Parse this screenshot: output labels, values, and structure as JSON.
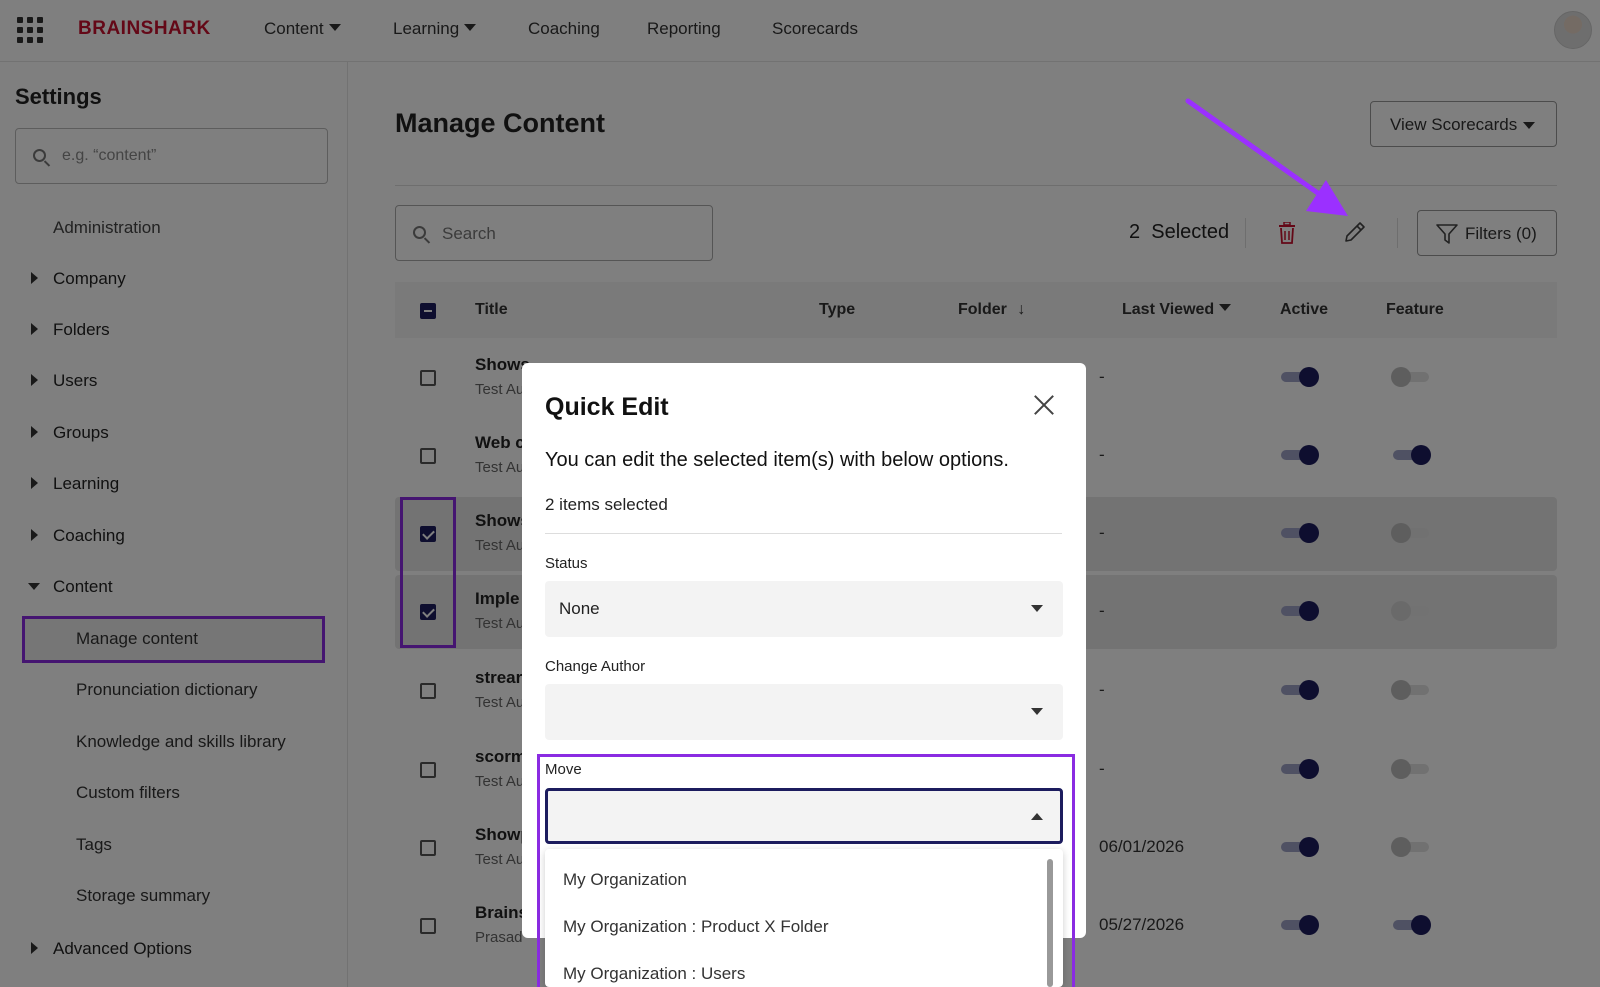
{
  "topbar": {
    "logo": "BRAINSHARK",
    "nav": [
      {
        "label": "Content",
        "has_caret": true
      },
      {
        "label": "Learning",
        "has_caret": true
      },
      {
        "label": "Coaching",
        "has_caret": false
      },
      {
        "label": "Reporting",
        "has_caret": false
      },
      {
        "label": "Scorecards",
        "has_caret": false
      }
    ]
  },
  "sidebar": {
    "title": "Settings",
    "search_placeholder": "e.g. “content”",
    "administration": "Administration",
    "sections": [
      "Company",
      "Folders",
      "Users",
      "Groups",
      "Learning",
      "Coaching",
      "Content"
    ],
    "content_items": [
      "Manage content",
      "Pronunciation dictionary",
      "Knowledge and skills library",
      "Custom filters",
      "Tags",
      "Storage summary"
    ],
    "advanced": "Advanced Options"
  },
  "main": {
    "title": "Manage Content",
    "view_scorecards": "View Scorecards",
    "search_placeholder": "Search",
    "selected_count": "2",
    "selected_label": "Selected",
    "filters_label": "Filters (0)",
    "columns": {
      "title": "Title",
      "type": "Type",
      "folder": "Folder",
      "last_viewed": "Last Viewed",
      "active": "Active",
      "feature": "Feature"
    },
    "rows": [
      {
        "title": "Shows",
        "sub": "Test Au",
        "last": "-",
        "checked": false,
        "active": true,
        "feature": false
      },
      {
        "title": "Web c",
        "sub": "Test Au",
        "last": "-",
        "checked": false,
        "active": true,
        "feature": true
      },
      {
        "title": "Shows",
        "sub": "Test Au",
        "last": "-",
        "checked": true,
        "active": true,
        "feature": false
      },
      {
        "title": "Imple",
        "sub": "Test Au",
        "last": "-",
        "checked": true,
        "active": true,
        "feature": false
      },
      {
        "title": "strear",
        "sub": "Test Au",
        "last": "-",
        "checked": false,
        "active": true,
        "feature": false
      },
      {
        "title": "scorm",
        "sub": "Test Au",
        "last": "-",
        "checked": false,
        "active": true,
        "feature": false
      },
      {
        "title": "Showp",
        "sub": "Test Au",
        "last": "06/01/2026",
        "checked": false,
        "active": true,
        "feature": false
      },
      {
        "title": "Brains",
        "sub": "Prasad",
        "last": "05/27/2026",
        "checked": false,
        "active": true,
        "feature": true
      }
    ]
  },
  "modal": {
    "title": "Quick Edit",
    "description": "You can edit the selected item(s) with below options.",
    "count": "2 items selected",
    "status_label": "Status",
    "status_value": "None",
    "author_label": "Change Author",
    "author_value": "",
    "move_label": "Move",
    "move_value": "",
    "move_options": [
      "My Organization",
      "My Organization : Product X Folder",
      "My Organization : Users"
    ]
  },
  "colors": {
    "accent": "#1c1c5e",
    "brand": "#c8102e",
    "highlight": "#8a2be2",
    "danger": "#c8102e"
  }
}
